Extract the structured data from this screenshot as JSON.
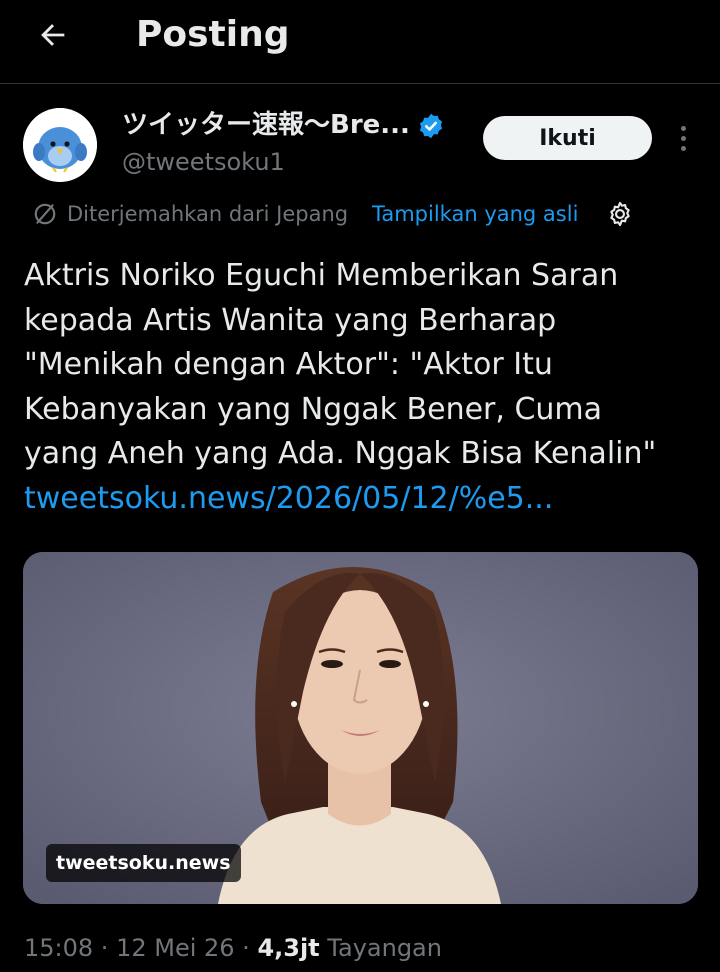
{
  "header": {
    "title": "Posting",
    "back_icon": "arrow-left-icon"
  },
  "author": {
    "display_name": "ツイッター速報〜Bre...",
    "handle": "@tweetsoku1",
    "verified_color": "#1d9bf0",
    "follow_label": "Ikuti",
    "more_icon": "more-vertical-icon"
  },
  "translation": {
    "note": "Diterjemahkan dari Jepang",
    "show_original_label": "Tampilkan yang asli",
    "icon": "translate-icon",
    "settings_icon": "gear-icon"
  },
  "tweet": {
    "lines": [
      "Aktris Noriko Eguchi Memberikan Saran",
      "kepada Artis Wanita yang Berharap",
      "\"Menikah dengan Aktor\": \"Aktor Itu",
      "Kebanyakan yang Nggak Bener, Cuma",
      "yang Aneh yang Ada. Nggak Bisa Kenalin\""
    ],
    "link": "tweetsoku.news/2026/05/12/%e5..."
  },
  "media": {
    "source_label": "tweetsoku.news"
  },
  "meta": {
    "time": "15:08",
    "separator": " · ",
    "date": "12 Mei 26",
    "views_count": "4,3jt",
    "views_label": "Tayangan"
  },
  "colors": {
    "background": "#000000",
    "text": "#e7e9ea",
    "muted": "#71767b",
    "accent": "#1d9bf0"
  }
}
